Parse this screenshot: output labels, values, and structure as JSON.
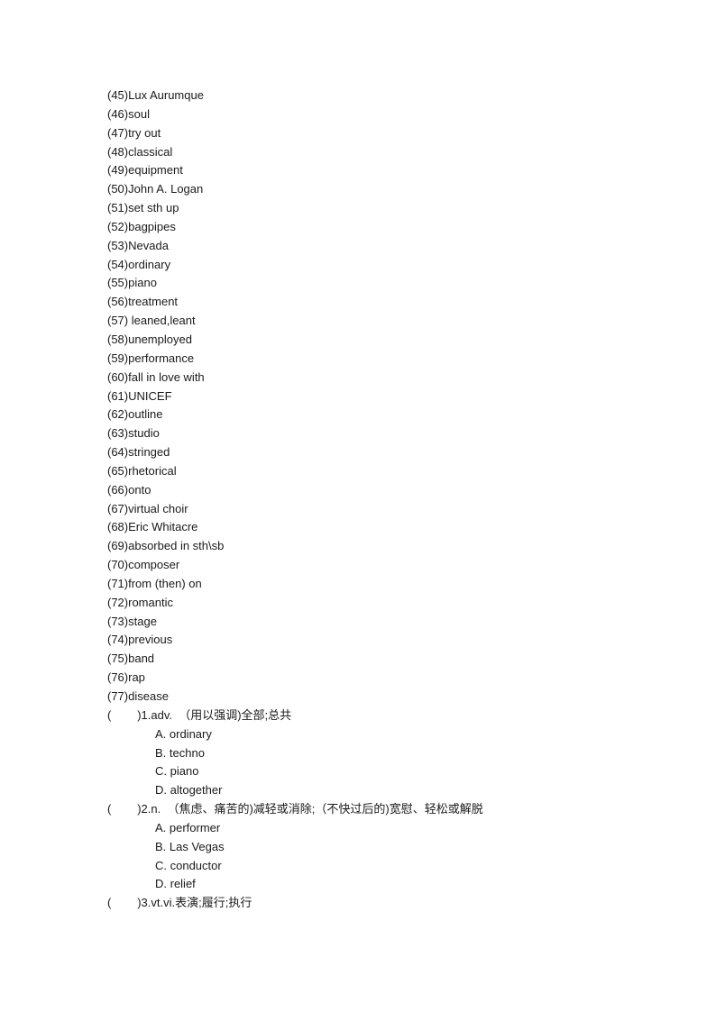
{
  "document": {
    "vocabulary_list": [
      "(45)Lux Aurumque",
      "(46)soul",
      "(47)try out",
      "(48)classical",
      "(49)equipment",
      "(50)John A. Logan",
      "(51)set sth up",
      "(52)bagpipes",
      "(53)Nevada",
      "(54)ordinary",
      "(55)piano",
      "(56)treatment",
      "(57) leaned,leant",
      "(58)unemployed",
      "(59)performance",
      "(60)fall in love with",
      "(61)UNICEF",
      "(62)outline",
      "(63)studio",
      "(64)stringed",
      "(65)rhetorical",
      "(66)onto",
      "(67)virtual choir",
      "(68)Eric Whitacre",
      "(69)absorbed in sth\\sb",
      "(70)composer",
      "(71)from (then) on",
      "(72)romantic",
      "(73)stage",
      "(74)previous",
      "(75)band",
      "(76)rap",
      "(77)disease"
    ],
    "questions": [
      {
        "prompt": "(        )1.adv.  （用以强调)全部;总共",
        "options": [
          "A. ordinary",
          "B. techno",
          "C. piano",
          "D. altogether"
        ]
      },
      {
        "prompt": "(        )2.n.  （焦虑、痛苦的)减轻或消除;（不快过后的)宽慰、轻松或解脱",
        "options": [
          "A. performer",
          "B. Las Vegas",
          "C. conductor",
          "D. relief"
        ]
      },
      {
        "prompt": "(        )3.vt.vi.表演;履行;执行",
        "options": []
      }
    ]
  }
}
